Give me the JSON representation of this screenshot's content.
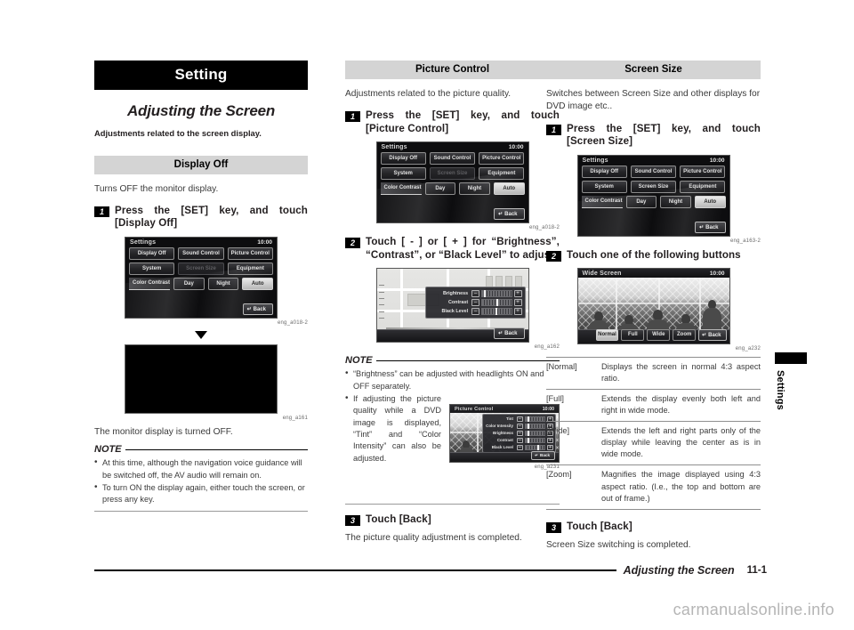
{
  "document": {
    "chapter_bar": "Setting",
    "section_title": "Adjusting the Screen",
    "section_lead": "Adjustments related to the screen display.",
    "footer_title": "Adjusting the Screen",
    "footer_page": "11-1",
    "side_tab_label": "Settings",
    "watermark": "carmanualsonline.info"
  },
  "left_column": {
    "heading": "Display Off",
    "intro": "Turns OFF the monitor display.",
    "step1": {
      "num": "1",
      "text": "Press the [SET] key, and touch [Display Off]"
    },
    "figure1_caption": "eng_a018-2",
    "figure2_caption": "eng_a161",
    "after_text": "The monitor display is turned OFF.",
    "note_label": "NOTE",
    "notes": [
      "At this time, although the navigation voice guidance will be switched off, the AV audio will remain on.",
      "To turn ON the display again, either touch the screen, or press any key."
    ]
  },
  "middle_column": {
    "heading": "Picture Control",
    "intro": "Adjustments related to the picture quality.",
    "step1": {
      "num": "1",
      "text": "Press the [SET] key, and touch [Picture Control]"
    },
    "figure1_caption": "eng_a018-2",
    "step2": {
      "num": "2",
      "text": "Touch [ - ] or [ + ] for “Brightness”, “Contrast”, or “Black Level” to adjust"
    },
    "figure2_caption": "eng_a162",
    "note_label": "NOTE",
    "notes": [
      "“Brightness” can be adjusted with headlights ON and OFF separately.",
      "If adjusting the picture quality while a DVD image is displayed, “Tint” and “Color Intensity” can also be adjusted."
    ],
    "figure3_caption": "eng_a231",
    "step3": {
      "num": "3",
      "text": "Touch [Back]"
    },
    "closing": "The picture quality adjustment is completed."
  },
  "right_column": {
    "heading": "Screen Size",
    "intro": "Switches between Screen Size and other displays for DVD image etc..",
    "step1": {
      "num": "1",
      "text": "Press the [SET] key, and touch [Screen Size]"
    },
    "figure1_caption": "eng_a163-2",
    "step2": {
      "num": "2",
      "text": "Touch one of the following buttons"
    },
    "figure2_caption": "eng_a232",
    "table": [
      {
        "key": "[Normal]",
        "value": "Displays the screen in normal 4:3 aspect ratio."
      },
      {
        "key": "[Full]",
        "value": "Extends the display evenly both left and right in wide mode."
      },
      {
        "key": "[Wide]",
        "value": "Extends the left and right parts only of the display while leaving the center as is in wide mode."
      },
      {
        "key": "[Zoom]",
        "value": "Magnifies the image displayed using 4:3 aspect ratio. (I.e., the top and bottom are out of frame.)"
      }
    ],
    "step3": {
      "num": "3",
      "text": "Touch [Back]"
    },
    "closing": "Screen Size switching is completed."
  },
  "screens": {
    "settings_disabled_screensize": {
      "title": "Settings",
      "clock": "10:00",
      "row1": [
        "Display Off",
        "Sound Control",
        "Picture Control"
      ],
      "row2": [
        "System",
        "Screen Size",
        "Equipment"
      ],
      "contrast_label": "Color Contrast",
      "contrast_options": [
        "Day",
        "Night",
        "Auto"
      ],
      "contrast_selected": "Auto",
      "back": "Back"
    },
    "settings_enabled_screensize": {
      "title": "Settings",
      "clock": "10:00",
      "row1": [
        "Display Off",
        "Sound Control",
        "Picture Control"
      ],
      "row2": [
        "System",
        "Screen Size",
        "Equipment"
      ],
      "contrast_label": "Color Contrast",
      "contrast_options": [
        "Day",
        "Night",
        "Auto"
      ],
      "contrast_selected": "Auto",
      "back": "Back"
    },
    "picture_control": {
      "title": "Picture Control",
      "clock": "10:00",
      "rows": [
        "Brightness",
        "Contrast",
        "Black Level"
      ],
      "minus": "–",
      "plus": "+",
      "back": "Back"
    },
    "picture_control_dvd": {
      "title": "Picture Control",
      "clock": "10:00",
      "rows": [
        "Tint",
        "Color Intensity",
        "Brightness",
        "Contrast",
        "Black Level"
      ],
      "minus": "–",
      "plus": "+",
      "back": "Back"
    },
    "wide_screen": {
      "title": "Wide Screen",
      "clock": "10:00",
      "buttons": [
        "Normal",
        "Full",
        "Wide",
        "Zoom"
      ],
      "selected": "Normal",
      "back": "Back"
    }
  }
}
